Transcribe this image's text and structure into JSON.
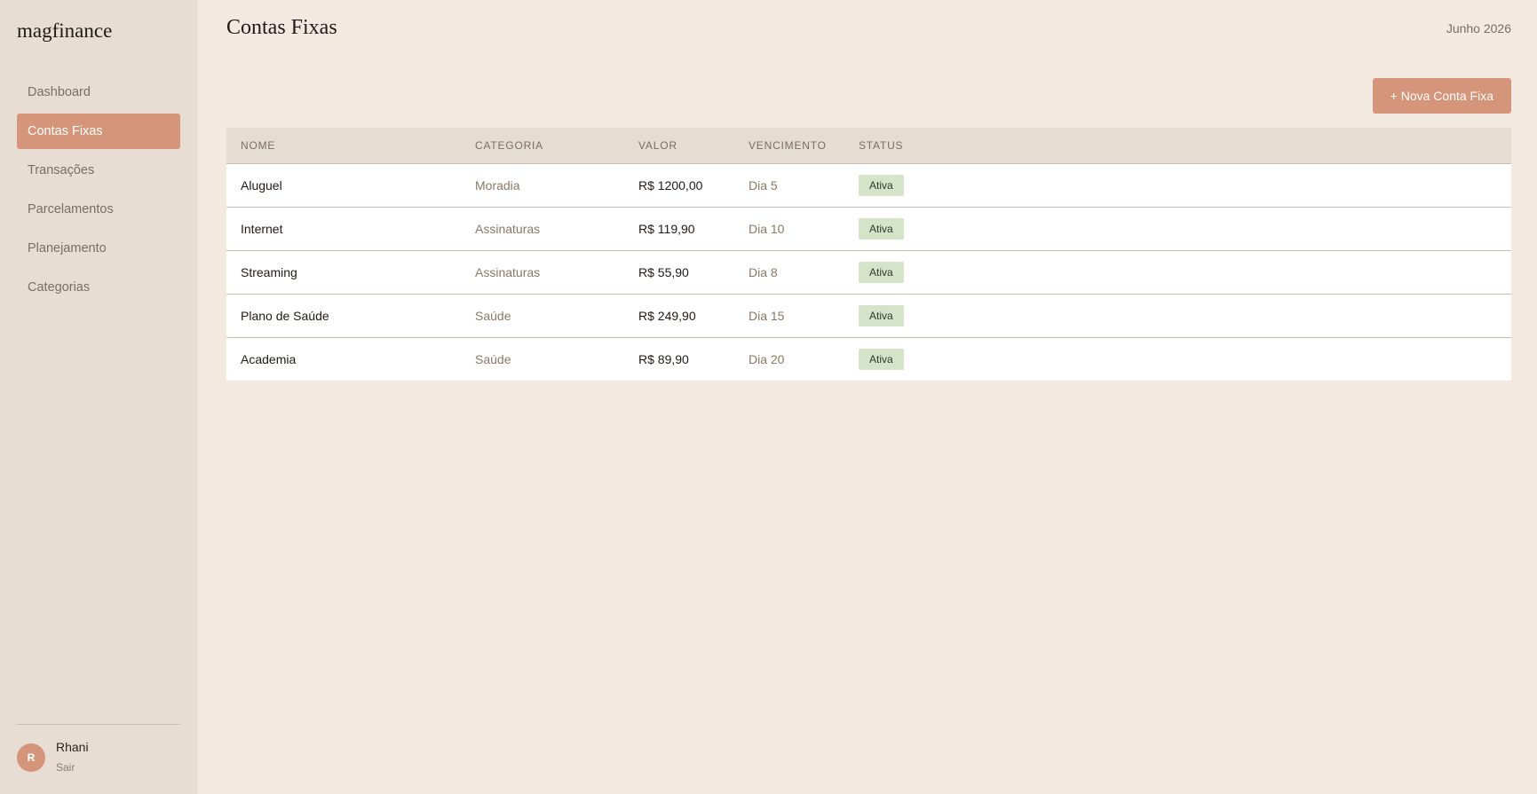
{
  "app": {
    "logo": "magfinance"
  },
  "sidebar": {
    "items": [
      {
        "label": "Dashboard",
        "active": false
      },
      {
        "label": "Contas Fixas",
        "active": true
      },
      {
        "label": "Transações",
        "active": false
      },
      {
        "label": "Parcelamentos",
        "active": false
      },
      {
        "label": "Planejamento",
        "active": false
      },
      {
        "label": "Categorias",
        "active": false
      }
    ],
    "user": {
      "initial": "R",
      "name": "Rhani",
      "logout_label": "Sair"
    }
  },
  "header": {
    "title": "Contas Fixas",
    "month": "Junho 2026",
    "new_button_label": "+ Nova Conta Fixa"
  },
  "table": {
    "columns": [
      "NOME",
      "CATEGORIA",
      "VALOR",
      "VENCIMENTO",
      "STATUS"
    ],
    "rows": [
      {
        "name": "Aluguel",
        "category": "Moradia",
        "value": "R$ 1200,00",
        "due": "Dia 5",
        "status": "Ativa"
      },
      {
        "name": "Internet",
        "category": "Assinaturas",
        "value": "R$ 119,90",
        "due": "Dia 10",
        "status": "Ativa"
      },
      {
        "name": "Streaming",
        "category": "Assinaturas",
        "value": "R$ 55,90",
        "due": "Dia 8",
        "status": "Ativa"
      },
      {
        "name": "Plano de Saúde",
        "category": "Saúde",
        "value": "R$ 249,90",
        "due": "Dia 15",
        "status": "Ativa"
      },
      {
        "name": "Academia",
        "category": "Saúde",
        "value": "R$ 89,90",
        "due": "Dia 20",
        "status": "Ativa"
      }
    ]
  },
  "colors": {
    "accent": "#d4957a",
    "background": "#f2e9e0",
    "sidebar": "#e8ddd3",
    "status_badge": "#d5e4c8"
  }
}
